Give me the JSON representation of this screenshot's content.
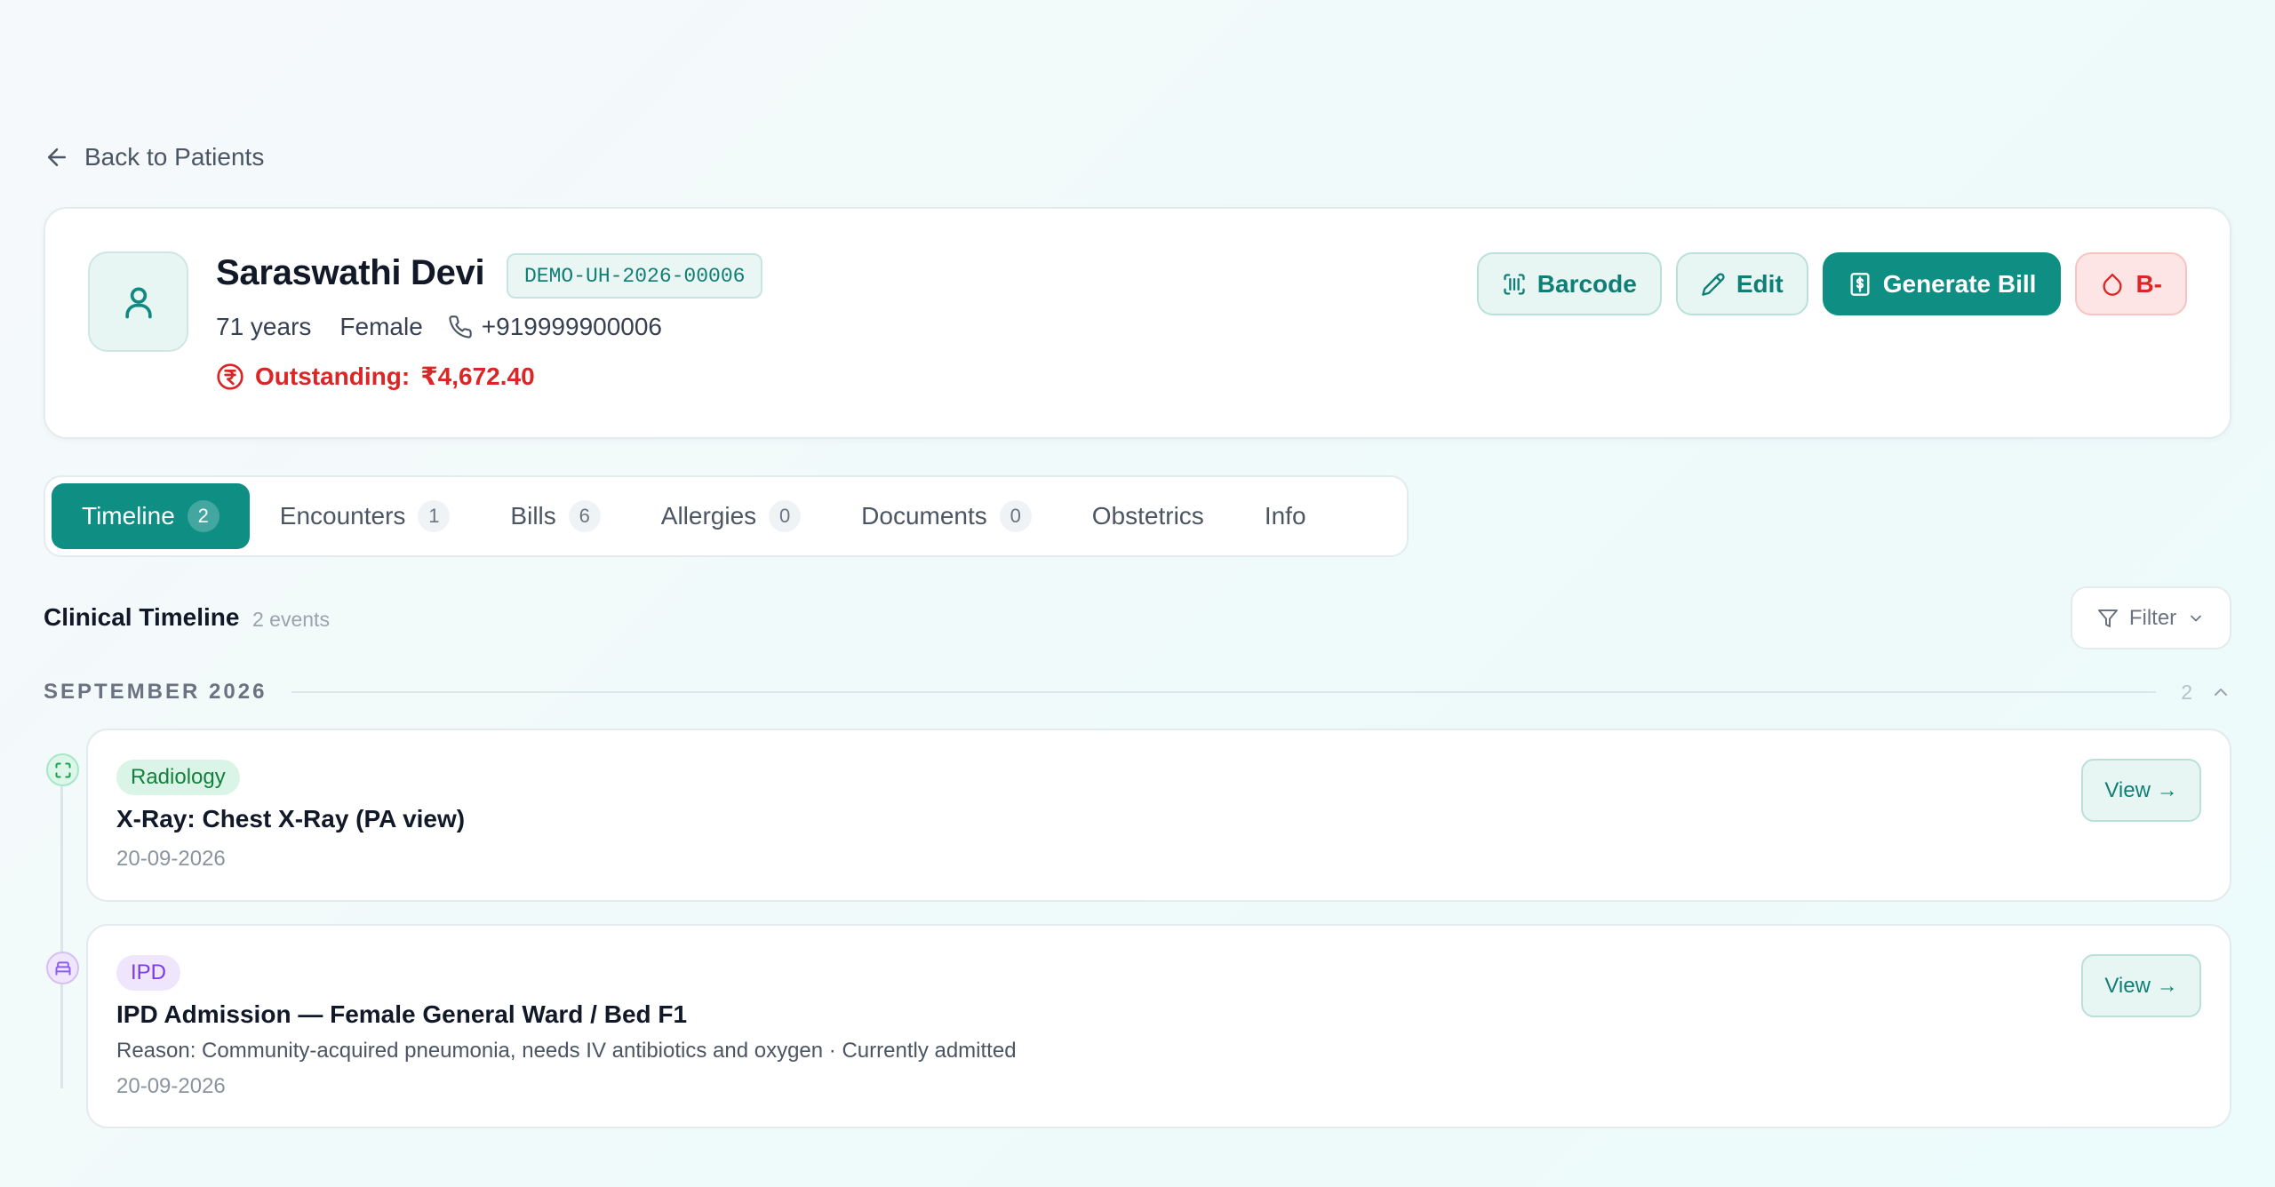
{
  "nav": {
    "back_label": "Back to Patients"
  },
  "patient": {
    "name": "Saraswathi Devi",
    "uhid": "DEMO-UH-2026-00006",
    "age": "71 years",
    "gender": "Female",
    "phone": "+919999900006",
    "outstanding_label": "Outstanding:",
    "outstanding_amount": "₹4,672.40",
    "blood_group": "B-"
  },
  "actions": {
    "barcode_label": "Barcode",
    "edit_label": "Edit",
    "generate_bill_label": "Generate Bill"
  },
  "tabs": [
    {
      "label": "Timeline",
      "count": "2"
    },
    {
      "label": "Encounters",
      "count": "1"
    },
    {
      "label": "Bills",
      "count": "6"
    },
    {
      "label": "Allergies",
      "count": "0"
    },
    {
      "label": "Documents",
      "count": "0"
    },
    {
      "label": "Obstetrics"
    },
    {
      "label": "Info"
    }
  ],
  "timeline": {
    "title": "Clinical Timeline",
    "count_label": "2 events",
    "filter_label": "Filter",
    "month": "SEPTEMBER 2026",
    "month_count": "2",
    "events": [
      {
        "category": "Radiology",
        "title": "X-Ray: Chest X-Ray (PA view)",
        "date": "20-09-2026",
        "view_label": "View →"
      },
      {
        "category": "IPD",
        "title": "IPD Admission — Female General Ward / Bed F1",
        "reason": "Reason: Community-acquired pneumonia, needs IV antibiotics and oxygen · Currently admitted",
        "date": "20-09-2026",
        "view_label": "View →"
      }
    ]
  },
  "colors": {
    "primary": "#0f8f84",
    "danger": "#dc2626",
    "radiology": "#15803d",
    "ipd": "#7c3aed"
  },
  "icons": {
    "back": "arrow-left-icon",
    "avatar": "user-icon",
    "phone": "phone-icon",
    "outstanding": "rupee-circle-icon",
    "barcode": "barcode-scan-icon",
    "edit": "pencil-icon",
    "bill": "receipt-icon",
    "blood": "droplet-icon",
    "filter": "funnel-icon",
    "radiology": "scan-icon",
    "ipd": "bed-icon"
  }
}
